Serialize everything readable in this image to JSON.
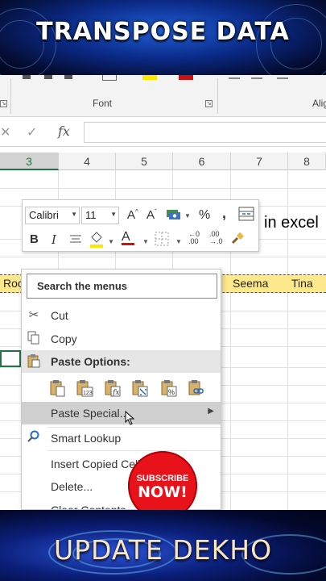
{
  "banner_top": {
    "title": "TRANSPOSE DATA"
  },
  "ribbon": {
    "font_group_label": "Font",
    "alignment_group_label": "Alig"
  },
  "formula_bar": {
    "fx_label": "fx",
    "cancel_glyph": "✕",
    "enter_glyph": "✓"
  },
  "grid": {
    "columns": [
      "3",
      "4",
      "5",
      "6",
      "7",
      "8"
    ],
    "selected_column": "3",
    "title_cell_text": "in excel",
    "row_start_text": "Roc",
    "names": [
      "Seema",
      "Tina"
    ]
  },
  "mini_toolbar": {
    "font_name": "Calibri",
    "font_size": "11",
    "buttons": [
      "bold",
      "italic",
      "align-center",
      "fill-color",
      "font-color",
      "borders",
      "increase-decimal",
      "decrease-decimal",
      "format-painter",
      "increase-font",
      "decrease-font",
      "accounting-format",
      "percent",
      "comma-style",
      "merge-center"
    ],
    "percent_glyph": "%",
    "comma_glyph": ","
  },
  "context_menu": {
    "search_label": "Search the menus",
    "cut": "Cut",
    "copy": "Copy",
    "paste_options": "Paste Options:",
    "paste_special": "Paste Special...",
    "smart_lookup": "Smart Lookup",
    "insert_copied_cells": "Insert Copied Cells...",
    "delete": "Delete...",
    "clear_contents": "Clear Contents"
  },
  "subscribe": {
    "line1": "SUBSCRIBE",
    "line2": "NOW!"
  },
  "banner_bottom": {
    "title": "UPDATE DEKHO"
  },
  "colors": {
    "excel_green": "#217346",
    "highlight_yellow": "#fde98c",
    "subscribe_red": "#e8121b"
  }
}
